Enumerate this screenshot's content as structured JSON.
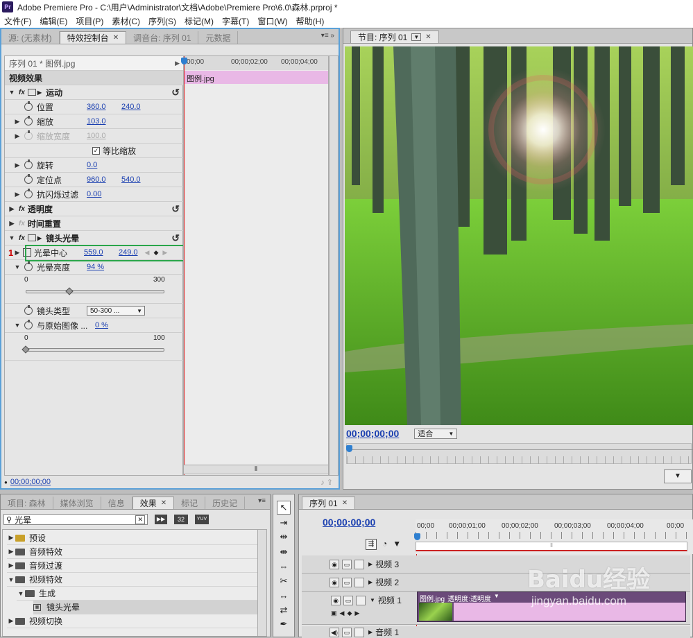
{
  "titlebar": {
    "app_icon": "Pr",
    "title": "Adobe Premiere Pro - C:\\用户\\Administrator\\文档\\Adobe\\Premiere Pro\\6.0\\森林.prproj *"
  },
  "menu": [
    "文件(F)",
    "编辑(E)",
    "项目(P)",
    "素材(C)",
    "序列(S)",
    "标记(M)",
    "字幕(T)",
    "窗口(W)",
    "帮助(H)"
  ],
  "top_left_tabs": {
    "source": "源: (无素材)",
    "effect_controls": "特效控制台",
    "audio_mixer": "调音台: 序列 01",
    "metadata": "元数据"
  },
  "effect_controls": {
    "sequence_label": "序列 01 * 图例.jpg",
    "video_effects": "视频效果",
    "timeline_times": [
      "00;00",
      "00;00;02;00",
      "00;00;04;00"
    ],
    "clip_label": "图例.jpg",
    "motion": "运动",
    "position": {
      "label": "位置",
      "x": "360.0",
      "y": "240.0"
    },
    "scale": {
      "label": "缩放",
      "value": "103.0"
    },
    "scale_width": {
      "label": "缩放宽度",
      "value": "100.0"
    },
    "uniform_scale": {
      "label": "等比缩放",
      "checked": true
    },
    "rotation": {
      "label": "旋转",
      "value": "0.0"
    },
    "anchor": {
      "label": "定位点",
      "x": "960.0",
      "y": "540.0"
    },
    "antiflicker": {
      "label": "抗闪烁过滤",
      "value": "0.00"
    },
    "opacity": "透明度",
    "time_remap": "时间重置",
    "lens_flare": "镜头光晕",
    "flare_center": {
      "label": "光晕中心",
      "x": "559.0",
      "y": "249.0"
    },
    "step_marker": "1",
    "flare_brightness": {
      "label": "光晕亮度",
      "value": "94 %",
      "min": "0",
      "max": "300",
      "level": 94
    },
    "lens_type": {
      "label": "镜头类型",
      "value": "50-300 ..."
    },
    "blend": {
      "label": "与原始图像 ...",
      "value": "0 %",
      "min": "0",
      "max": "100",
      "level": 0
    },
    "timecode": "00;00;00;00"
  },
  "program": {
    "tab": "节目: 序列 01",
    "timecode": "00;00;00;00",
    "fit": "适合"
  },
  "bottom_left_tabs": {
    "project": "项目: 森林",
    "media_browser": "媒体浏览",
    "info": "信息",
    "effects": "效果",
    "markers": "标记",
    "history": "历史记"
  },
  "effects_panel": {
    "search_value": "光晕",
    "badges": [
      "32",
      "YUV"
    ],
    "tree": [
      {
        "label": "预设",
        "depth": 0,
        "open": false
      },
      {
        "label": "音频特效",
        "depth": 0,
        "open": false
      },
      {
        "label": "音频过渡",
        "depth": 0,
        "open": false
      },
      {
        "label": "视频特效",
        "depth": 0,
        "open": true
      },
      {
        "label": "生成",
        "depth": 1,
        "open": true
      },
      {
        "label": "镜头光晕",
        "depth": 2,
        "open": false
      },
      {
        "label": "视频切换",
        "depth": 0,
        "open": false
      }
    ]
  },
  "timeline": {
    "tab": "序列 01",
    "timecode": "00;00;00;00",
    "ruler": [
      "00;00",
      "00;00;01;00",
      "00;00;02;00",
      "00;00;03;00",
      "00;00;04;00",
      "00;00"
    ],
    "tracks": {
      "v3": "视频 3",
      "v2": "视频 2",
      "v1": "视频 1",
      "a1": "音频 1"
    },
    "clip_label": "图例.jpg",
    "clip_fx": "透明度:透明度"
  },
  "watermark": {
    "logo": "Baidu经验",
    "url": "jingyan.baidu.com"
  }
}
